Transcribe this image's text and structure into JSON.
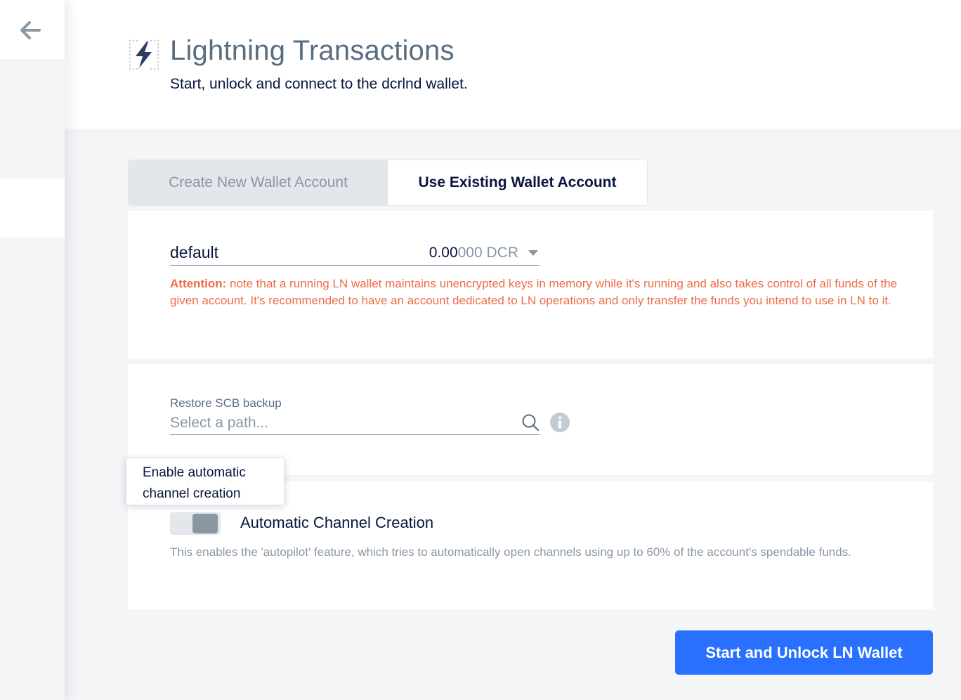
{
  "header": {
    "title": "Lightning Transactions",
    "subtitle": "Start, unlock and connect to the dcrlnd wallet."
  },
  "tabs": [
    {
      "label": "Create New Wallet Account",
      "active": false
    },
    {
      "label": "Use Existing Wallet Account",
      "active": true
    }
  ],
  "account": {
    "name": "default",
    "balance_main": "0.00",
    "balance_rest": "000 DCR"
  },
  "attention": {
    "label": "Attention:",
    "text": " note that a running LN wallet maintains unencrypted keys in memory while it's running and also takes control of all funds of the given account. It's recommended to have an account dedicated to LN operations and only transfer the funds you intend to use in LN to it."
  },
  "restore": {
    "label": "Restore SCB backup",
    "placeholder": "Select a path..."
  },
  "tooltip": {
    "line1": "Enable automatic",
    "line2": "channel creation"
  },
  "autopilot": {
    "toggle_label": "Automatic Channel Creation",
    "enabled": false,
    "description": "This enables the 'autopilot' feature, which tries to automatically open channels using up to 60% of the account's spendable funds."
  },
  "actions": {
    "primary_label": "Start and Unlock LN Wallet"
  },
  "colors": {
    "accent": "#2970ff",
    "warning": "#ed6d47",
    "title": "#596d81",
    "text": "#091440",
    "muted": "#8997a5"
  },
  "icons": {
    "back": "arrow-left-icon",
    "section": "lightning-icon",
    "search": "search-icon",
    "info": "info-icon",
    "dropdown": "caret-down-icon"
  }
}
